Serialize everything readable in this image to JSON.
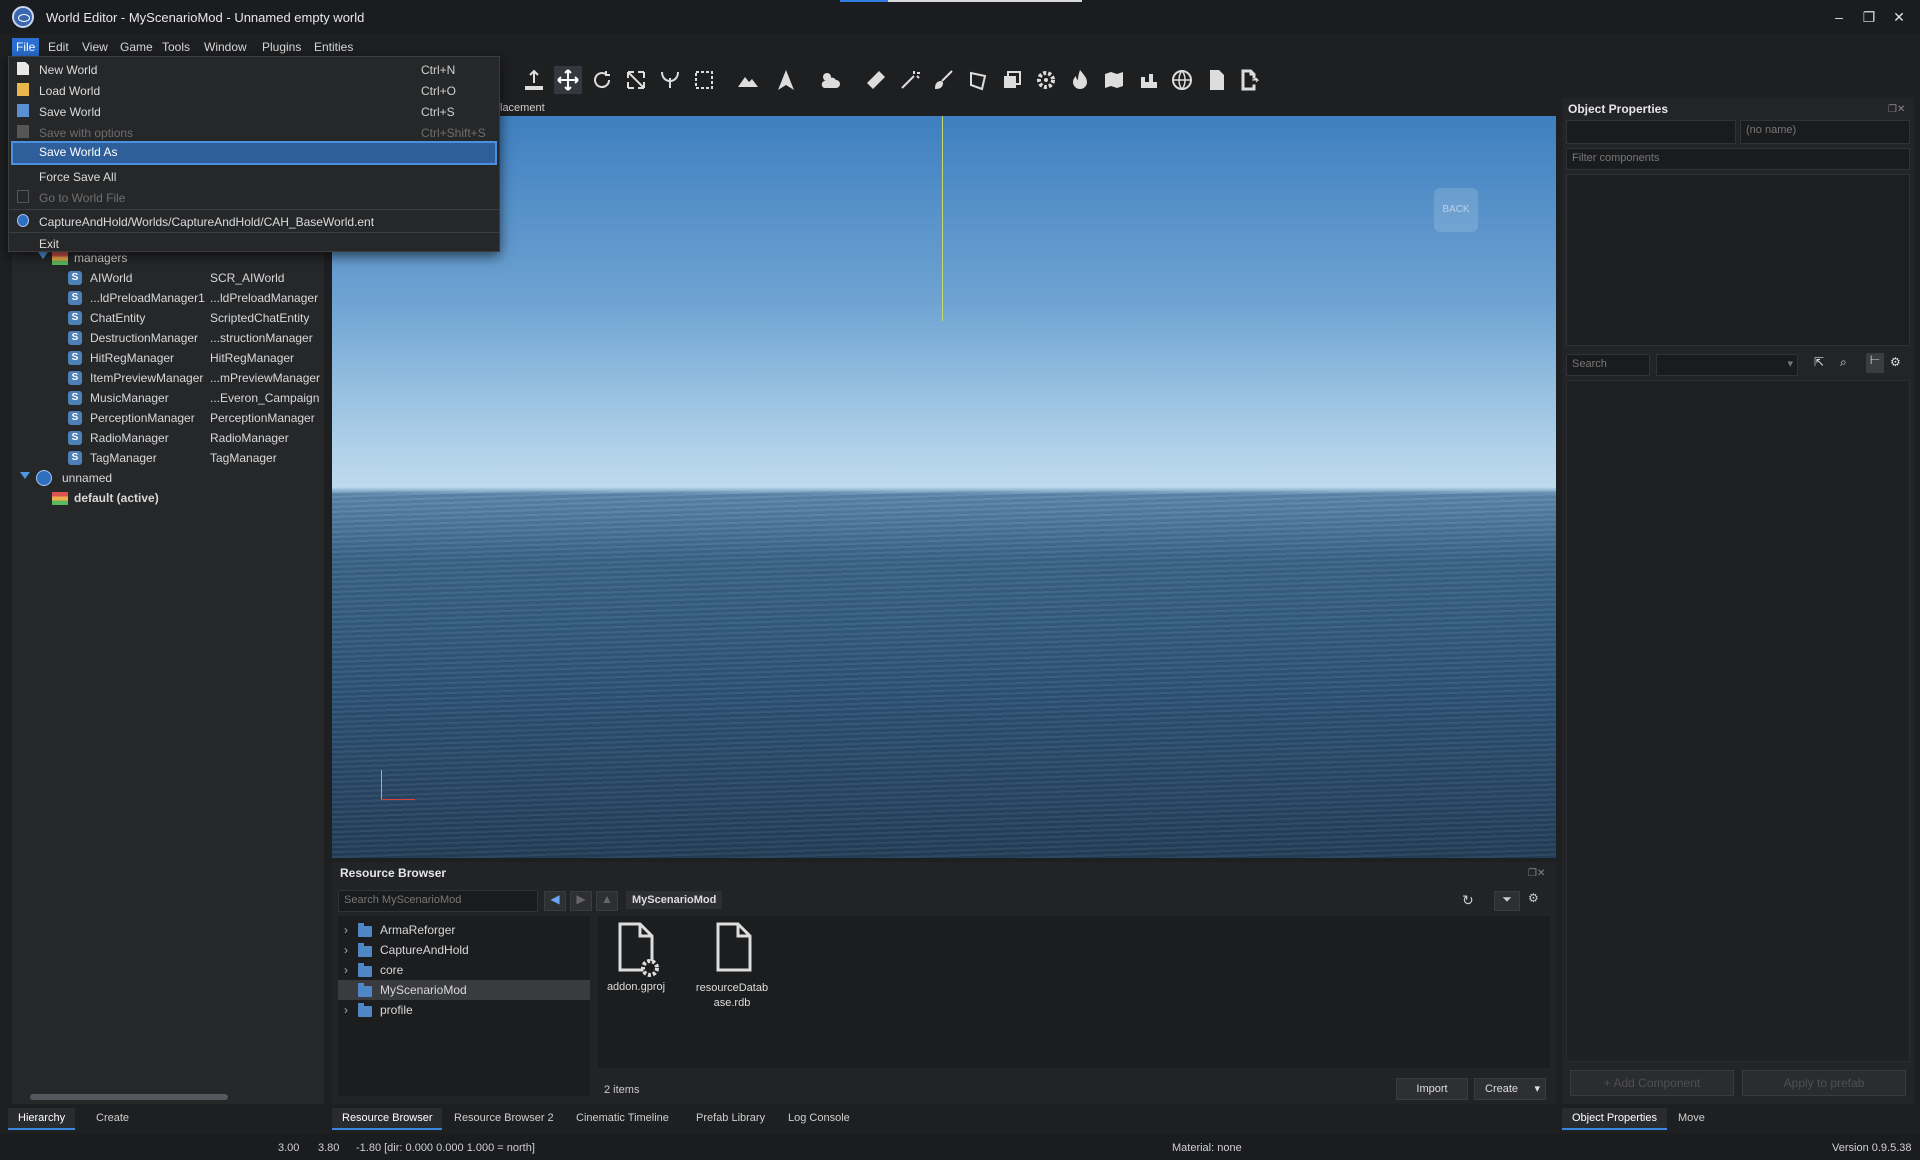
{
  "window": {
    "title": "World Editor - MyScenarioMod - Unnamed empty world"
  },
  "menubar": [
    "File",
    "Edit",
    "View",
    "Game",
    "Tools",
    "Window",
    "Plugins",
    "Entities"
  ],
  "file_menu": {
    "items": [
      {
        "label": "New World",
        "shortcut": "Ctrl+N",
        "enabled": true
      },
      {
        "label": "Load World",
        "shortcut": "Ctrl+O",
        "enabled": true
      },
      {
        "label": "Save World",
        "shortcut": "Ctrl+S",
        "enabled": true
      },
      {
        "label": "Save with options",
        "shortcut": "Ctrl+Shift+S",
        "enabled": false
      },
      {
        "label": "Save World As",
        "shortcut": "",
        "enabled": true,
        "highlighted": true
      },
      {
        "label": "Force Save All",
        "shortcut": "",
        "enabled": true
      },
      {
        "label": "Go to World File",
        "shortcut": "",
        "enabled": false
      },
      {
        "label": "CaptureAndHold/Worlds/CaptureAndHold/CAH_BaseWorld.ent",
        "shortcut": "",
        "enabled": true
      },
      {
        "label": "Exit",
        "shortcut": "",
        "enabled": true
      }
    ]
  },
  "viewport": {
    "tab_label": "lacement",
    "back_label": "BACK"
  },
  "hierarchy": {
    "managers_label": "managers",
    "entities": [
      {
        "name": "AIWorld",
        "type": "SCR_AIWorld"
      },
      {
        "name": "...ldPreloadManager1",
        "type": "...ldPreloadManager"
      },
      {
        "name": "ChatEntity",
        "type": "ScriptedChatEntity"
      },
      {
        "name": "DestructionManager",
        "type": "...structionManager"
      },
      {
        "name": "HitRegManager",
        "type": "HitRegManager"
      },
      {
        "name": "ItemPreviewManager",
        "type": "...mPreviewManager"
      },
      {
        "name": "MusicManager",
        "type": "...Everon_Campaign"
      },
      {
        "name": "PerceptionManager",
        "type": "PerceptionManager"
      },
      {
        "name": "RadioManager",
        "type": "RadioManager"
      },
      {
        "name": "TagManager",
        "type": "TagManager"
      }
    ],
    "world_label": "unnamed",
    "layer_label": "default (active)"
  },
  "left_tabs": [
    "Hierarchy",
    "Create"
  ],
  "object_properties": {
    "title": "Object Properties",
    "name_placeholder": "(no name)",
    "filter_placeholder": "Filter components",
    "search_placeholder": "Search",
    "add_component": "+ Add Component",
    "apply_prefab": "Apply to prefab",
    "tabs": [
      "Object Properties",
      "Move"
    ]
  },
  "resource_browser": {
    "title": "Resource Browser",
    "search_placeholder": "Search MyScenarioMod",
    "path": "MyScenarioMod",
    "folders": [
      "ArmaReforger",
      "CaptureAndHold",
      "core",
      "MyScenarioMod",
      "profile"
    ],
    "files": [
      "addon.gproj",
      "resourceDatab ase.rdb"
    ],
    "count": "2 items",
    "import": "Import",
    "create": "Create"
  },
  "bottom_tabs": [
    "Resource Browser",
    "Resource Browser 2",
    "Cinematic Timeline",
    "Prefab Library",
    "Log Console"
  ],
  "status": {
    "v1": "3.00",
    "v2": "3.80",
    "coords": "-1.80 [dir: 0.000  0.000  1.000 = north]",
    "material": "Material: none",
    "version": "Version 0.9.5.38"
  },
  "colors": {
    "accent": "#2a6fd1",
    "selection": "#2f5f9a",
    "sky": "#a7cbe6",
    "sea": "#2f567a"
  }
}
